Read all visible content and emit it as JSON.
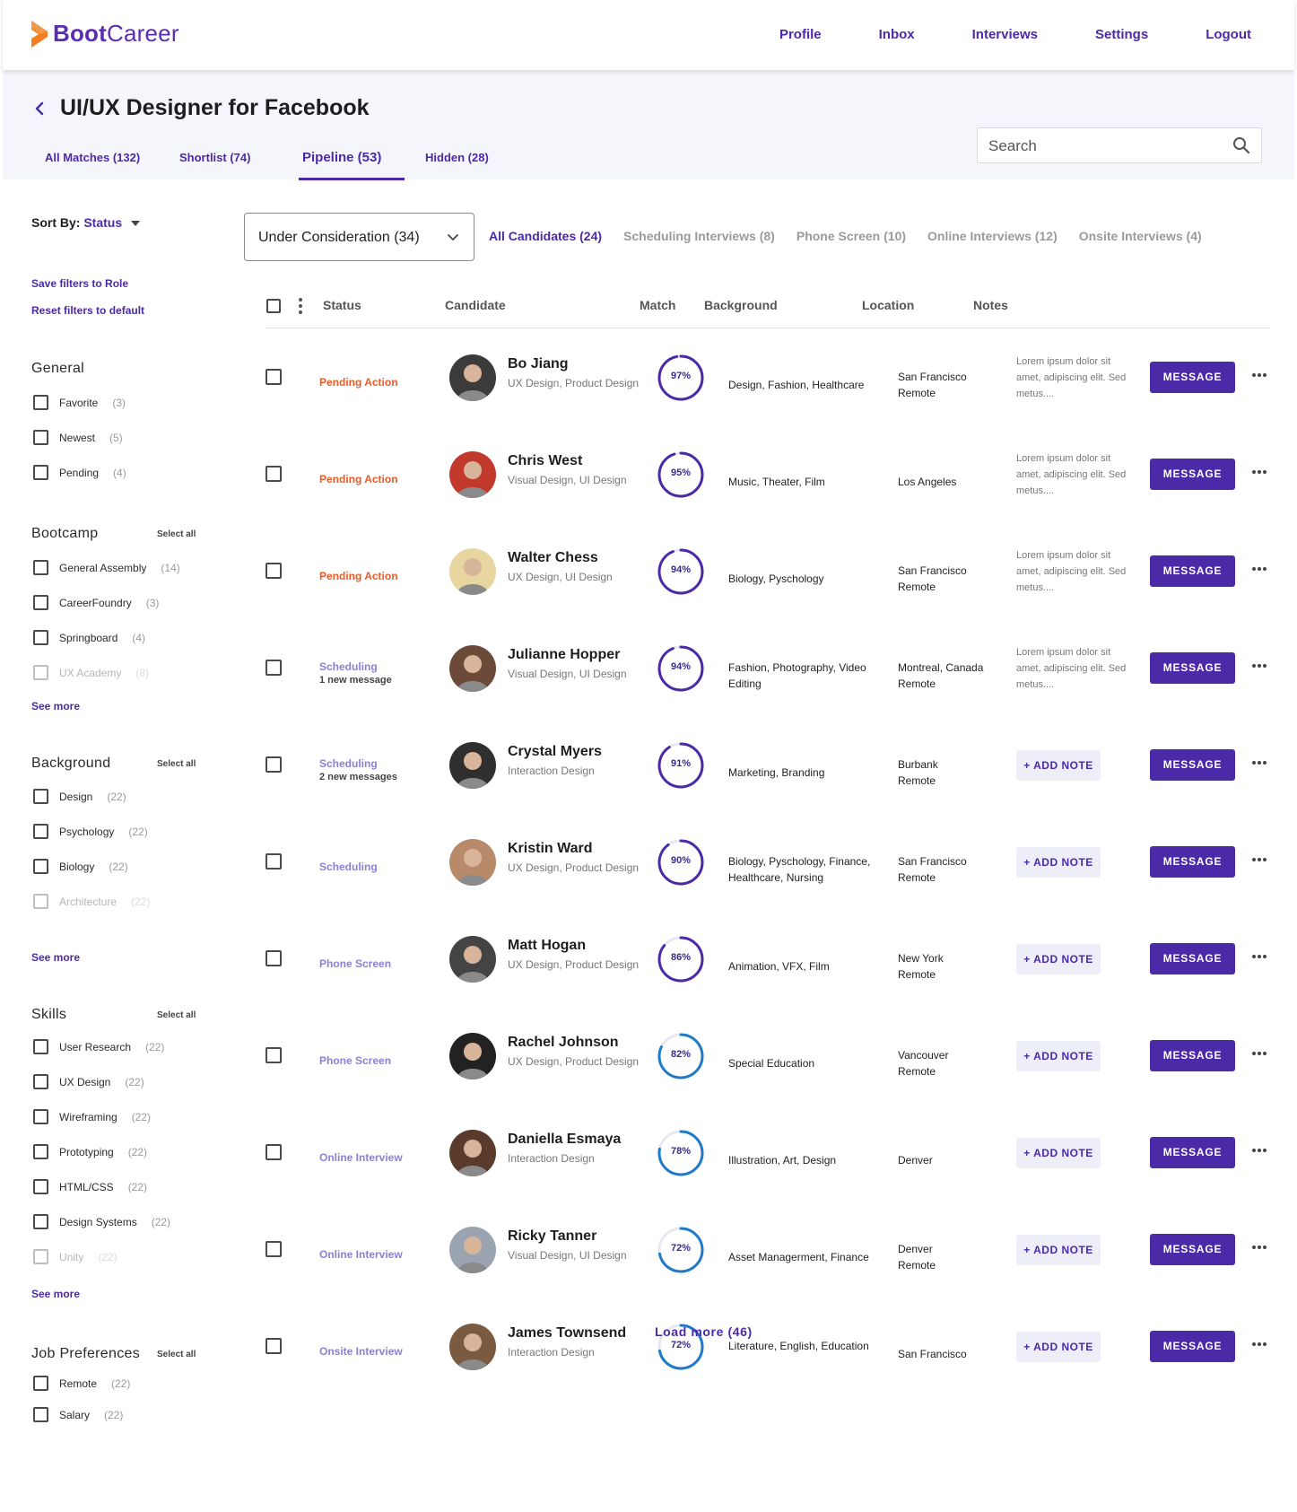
{
  "brand": {
    "name_bold": "Boot",
    "name_rest": "Career"
  },
  "nav": [
    "Profile",
    "Inbox",
    "Interviews",
    "Settings",
    "Logout"
  ],
  "page_title": "UI/UX Designer for Facebook",
  "tabs": [
    "All Matches (132)",
    "Shortlist (74)",
    "Pipeline (53)",
    "Hidden (28)"
  ],
  "active_tab": "Pipeline (53)",
  "search": {
    "placeholder": "Search"
  },
  "sidebar": {
    "sort_label": "Sort By:",
    "sort_value": "Status",
    "save_filters": "Save filters to Role",
    "reset_filters": "Reset filters to default",
    "select_all": "Select all",
    "see_more": "See more",
    "general": {
      "title": "General",
      "items": [
        {
          "label": "Favorite",
          "count": "(3)"
        },
        {
          "label": "Newest",
          "count": "(5)"
        },
        {
          "label": "Pending",
          "count": "(4)"
        }
      ]
    },
    "bootcamp": {
      "title": "Bootcamp",
      "items": [
        {
          "label": "General Assembly",
          "count": "(14)"
        },
        {
          "label": "CareerFoundry",
          "count": "(3)"
        },
        {
          "label": "Springboard",
          "count": "(4)"
        },
        {
          "label": "UX Academy",
          "count": "(8)"
        }
      ]
    },
    "background": {
      "title": "Background",
      "items": [
        {
          "label": "Design",
          "count": "(22)"
        },
        {
          "label": "Psychology",
          "count": "(22)"
        },
        {
          "label": "Biology",
          "count": "(22)"
        },
        {
          "label": "Architecture",
          "count": "(22)"
        }
      ]
    },
    "skills": {
      "title": "Skills",
      "items": [
        {
          "label": "User Research",
          "count": "(22)"
        },
        {
          "label": "UX Design",
          "count": "(22)"
        },
        {
          "label": "Wireframing",
          "count": "(22)"
        },
        {
          "label": "Prototyping",
          "count": "(22)"
        },
        {
          "label": "HTML/CSS",
          "count": "(22)"
        },
        {
          "label": "Design Systems",
          "count": "(22)"
        },
        {
          "label": "Unity",
          "count": "(22)"
        }
      ]
    },
    "job_preferences": {
      "title": "Job Preferences",
      "items": [
        {
          "label": "Remote",
          "count": "(22)"
        },
        {
          "label": "Salary",
          "count": "(22)"
        }
      ]
    }
  },
  "stage_select": "Under Consideration (34)",
  "filter_tabs": [
    "All Candidates (24)",
    "Scheduling Interviews (8)",
    "Phone Screen (10)",
    "Online Interviews (12)",
    "Onsite Interviews (4)"
  ],
  "table": {
    "columns": [
      "Status",
      "Candidate",
      "Match",
      "Background",
      "Location",
      "Notes"
    ],
    "add_note_label": "+ ADD NOTE",
    "message_label": "MESSAGE",
    "note_text": "Lorem ipsum dolor sit amet, adipiscing elit. Sed metus....",
    "rows": [
      {
        "status": "Pending Action",
        "status_sub": "",
        "status_color": "#ee5a24",
        "name": "Bo Jiang",
        "role": "UX Design, Product Design",
        "match": "97%",
        "match_value": 97,
        "background": "Design, Fashion, Healthcare",
        "location": [
          "San Francisco",
          "Remote"
        ],
        "note": true
      },
      {
        "status": "Pending Action",
        "status_sub": "",
        "status_color": "#ee5a24",
        "name": "Chris West",
        "role": "Visual Design, UI Design",
        "match": "95%",
        "match_value": 95,
        "background": "Music, Theater, Film",
        "location": [
          "Los Angeles"
        ],
        "note": true
      },
      {
        "status": "Pending Action",
        "status_sub": "",
        "status_color": "#ee5a24",
        "name": "Walter Chess",
        "role": "UX Design, UI Design",
        "match": "94%",
        "match_value": 94,
        "background": "Biology, Pyschology",
        "location": [
          "San Francisco",
          "Remote"
        ],
        "note": true
      },
      {
        "status": "Scheduling",
        "status_sub": "1 new message",
        "status_color": "#8e7fd6",
        "name": "Julianne Hopper",
        "role": "Visual Design, UI Design",
        "match": "94%",
        "match_value": 94,
        "background": "Fashion, Photography, Video Editing",
        "location": [
          "Montreal, Canada",
          "Remote"
        ],
        "note": true
      },
      {
        "status": "Scheduling",
        "status_sub": "2 new messages",
        "status_color": "#8e7fd6",
        "name": "Crystal Myers",
        "role": "Interaction Design",
        "match": "91%",
        "match_value": 91,
        "background": "Marketing, Branding",
        "location": [
          "Burbank",
          "Remote"
        ],
        "note": false
      },
      {
        "status": "Scheduling",
        "status_sub": "",
        "status_color": "#8e7fd6",
        "name": "Kristin Ward",
        "role": "UX Design, Product Design",
        "match": "90%",
        "match_value": 90,
        "background": "Biology, Pyschology, Finance, Healthcare, Nursing",
        "location": [
          "San Francisco",
          "Remote"
        ],
        "note": false
      },
      {
        "status": "Phone Screen",
        "status_sub": "",
        "status_color": "#8e7fd6",
        "name": "Matt Hogan",
        "role": "UX Design, Product Design",
        "match": "86%",
        "match_value": 86,
        "background": "Animation, VFX, Film",
        "location": [
          "New York",
          "Remote"
        ],
        "note": false
      },
      {
        "status": "Phone Screen",
        "status_sub": "",
        "status_color": "#8e7fd6",
        "name": "Rachel Johnson",
        "role": "UX Design, Product Design",
        "match": "82%",
        "match_value": 82,
        "background": "Special Education",
        "location": [
          "Vancouver",
          "Remote"
        ],
        "note": false
      },
      {
        "status": "Online Interview",
        "status_sub": "",
        "status_color": "#8e7fd6",
        "name": "Daniella Esmaya",
        "role": "Interaction Design",
        "match": "78%",
        "match_value": 78,
        "background": "Illustration, Art, Design",
        "location": [
          "Denver"
        ],
        "note": false
      },
      {
        "status": "Online Interview",
        "status_sub": "",
        "status_color": "#8e7fd6",
        "name": "Ricky Tanner",
        "role": "Visual Design, UI Design",
        "match": "72%",
        "match_value": 72,
        "background": "Asset Managerment, Finance",
        "location": [
          "Denver",
          "Remote"
        ],
        "note": false
      },
      {
        "status": "Onsite Interview",
        "status_sub": "",
        "status_color": "#8e7fd6",
        "name": "James Townsend",
        "role": "Interaction Design",
        "match": "72%",
        "match_value": 72,
        "background": "Literature, English, Education",
        "location": [
          "San Francisco"
        ],
        "note": false
      }
    ]
  },
  "load_more": "Load more (46)",
  "colors": {
    "accent": "#4b2aa8",
    "pending": "#ee5a24",
    "scheduling": "#8e7fd6",
    "ring_high": "#4b2aa8",
    "ring_low": "#1f7ac9"
  }
}
